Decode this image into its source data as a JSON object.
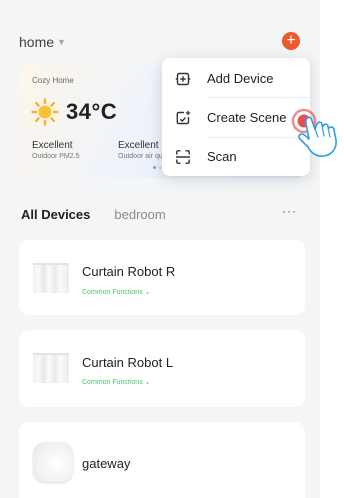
{
  "header": {
    "home_label": "home",
    "add_symbol": "+"
  },
  "weather": {
    "home_name": "Cozy Home",
    "temperature": "34°C",
    "metrics": [
      {
        "value": "Excellent",
        "label": "Outdoor PM2.5"
      },
      {
        "value": "Excellent",
        "label": "Outdoor air quality"
      }
    ]
  },
  "tabs": {
    "active": "All Devices",
    "other": "bedroom",
    "more": "···"
  },
  "devices": [
    {
      "name": "Curtain Robot  R",
      "functions": "Common Functions"
    },
    {
      "name": "Curtain Robot  L",
      "functions": "Common Functions"
    },
    {
      "name": "gateway"
    }
  ],
  "menu": {
    "items": [
      {
        "label": "Add Device",
        "icon": "add-device-icon"
      },
      {
        "label": "Create Scene",
        "icon": "create-scene-icon"
      },
      {
        "label": "Scan",
        "icon": "scan-icon"
      }
    ]
  },
  "colors": {
    "accent_orange": "#ee5a2b",
    "function_green": "#45c17a",
    "tap_red": "#e0322e"
  }
}
